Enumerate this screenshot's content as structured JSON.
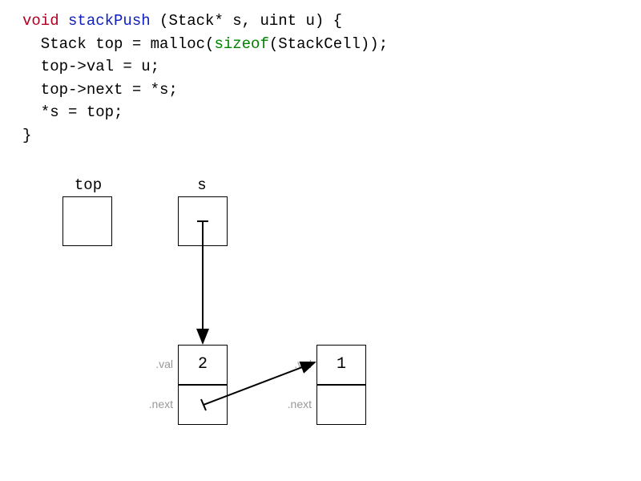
{
  "code": {
    "kw_void": "void",
    "fn_name": "stackPush",
    "sig_rest": " (Stack* s, uint u) {",
    "line2a": "  Stack top = malloc(",
    "kw_sizeof": "sizeof",
    "line2b": "(StackCell));",
    "line3": "  top->val = u;",
    "line4": "  top->next = *s;",
    "line5": "  *s = top;",
    "line6": "}"
  },
  "diagram": {
    "top_label": "top",
    "s_label": "s",
    "field_val": ".val",
    "field_next": ".next",
    "cell_left_val": "2",
    "cell_right_val": "1"
  }
}
